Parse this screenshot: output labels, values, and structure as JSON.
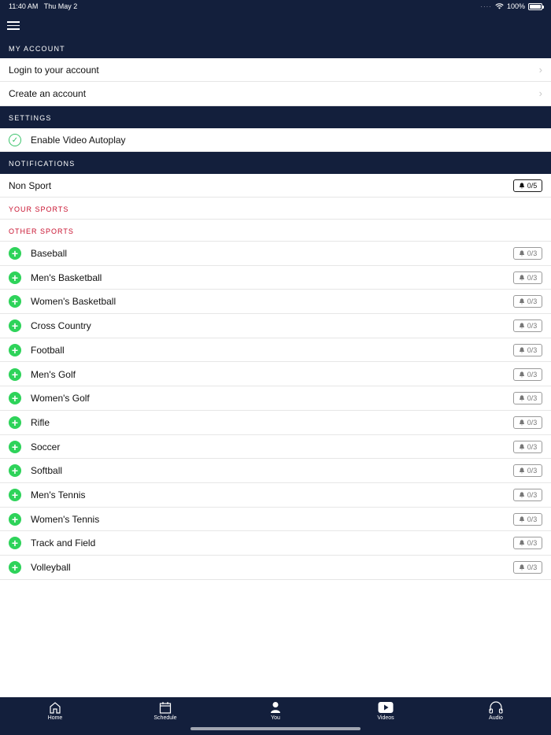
{
  "status_bar": {
    "time": "11:40 AM",
    "date": "Thu May 2",
    "battery": "100%"
  },
  "header": {
    "menu_icon": "hamburger-menu-icon"
  },
  "my_account": {
    "title": "MY ACCOUNT",
    "items": [
      {
        "label": "Login to your account"
      },
      {
        "label": "Create an account"
      }
    ]
  },
  "settings": {
    "title": "SETTINGS",
    "autoplay_label": "Enable Video Autoplay",
    "autoplay_enabled": true
  },
  "notifications": {
    "title": "NOTIFICATIONS",
    "non_sport": {
      "label": "Non Sport",
      "count": "0/5"
    },
    "your_sports_label": "YOUR SPORTS",
    "other_sports_label": "OTHER SPORTS",
    "sports": [
      {
        "name": "Baseball",
        "count": "0/3"
      },
      {
        "name": "Men's Basketball",
        "count": "0/3"
      },
      {
        "name": "Women's Basketball",
        "count": "0/3"
      },
      {
        "name": "Cross Country",
        "count": "0/3"
      },
      {
        "name": "Football",
        "count": "0/3"
      },
      {
        "name": "Men's Golf",
        "count": "0/3"
      },
      {
        "name": "Women's Golf",
        "count": "0/3"
      },
      {
        "name": "Rifle",
        "count": "0/3"
      },
      {
        "name": "Soccer",
        "count": "0/3"
      },
      {
        "name": "Softball",
        "count": "0/3"
      },
      {
        "name": "Men's Tennis",
        "count": "0/3"
      },
      {
        "name": "Women's Tennis",
        "count": "0/3"
      },
      {
        "name": "Track and Field",
        "count": "0/3"
      },
      {
        "name": "Volleyball",
        "count": "0/3"
      }
    ]
  },
  "tabbar": {
    "tabs": [
      {
        "label": "Home",
        "icon": "home-icon"
      },
      {
        "label": "Schedule",
        "icon": "calendar-icon"
      },
      {
        "label": "You",
        "icon": "user-icon"
      },
      {
        "label": "Videos",
        "icon": "play-icon"
      },
      {
        "label": "Audio",
        "icon": "headphones-icon"
      }
    ]
  },
  "colors": {
    "navy": "#131f3c",
    "accent_red": "#c8102e",
    "green": "#2ed35a"
  }
}
